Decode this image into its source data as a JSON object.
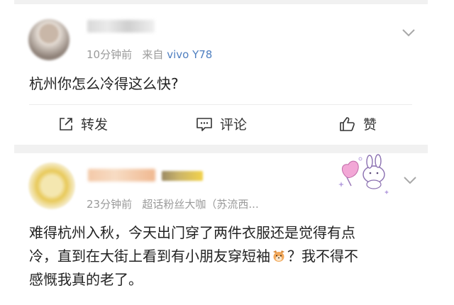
{
  "posts": [
    {
      "time": "10分钟前",
      "source_prefix": "来自",
      "source_model": "vivo Y78",
      "text": "杭州你怎么冷得这么快?",
      "actions": {
        "repost": "转发",
        "comment": "评论",
        "like": "赞"
      }
    },
    {
      "time": "23分钟前",
      "badge": "超话粉丝大咖（苏流西...",
      "text_line1": "难得杭州入秋，今天出门穿了两件衣服还是觉得有点",
      "text_line2a": "冷，直到在大街上看到有小朋友穿短袖",
      "text_line2b": "？我不得不",
      "text_line3": "感慨我真的老了。"
    }
  ],
  "icons": {
    "dropdown": "chevron-down-icon",
    "repost": "share-icon",
    "comment": "comment-icon",
    "like": "thumbs-up-icon",
    "emoji": "dog-face-emoji-icon",
    "sticker": "bunny-heart-sticker"
  },
  "colors": {
    "link": "#4f7fc0",
    "meta": "#9a9a9a",
    "separator": "#f1f1f1"
  }
}
